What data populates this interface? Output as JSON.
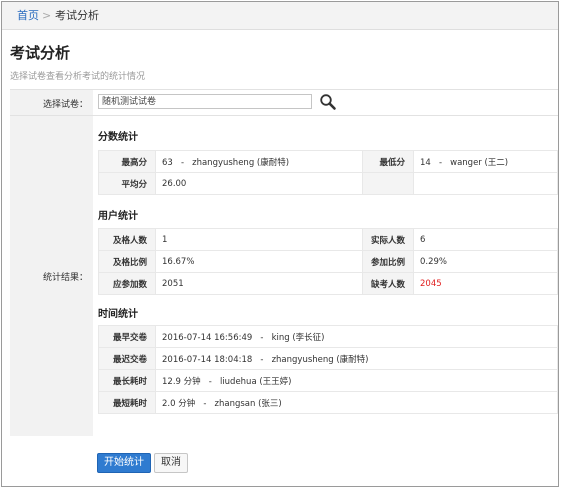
{
  "breadcrumb": {
    "home": "首页",
    "separator": ">",
    "current": "考试分析"
  },
  "page": {
    "title": "考试分析",
    "subtitle": "选择试卷查看分析考试的统计情况"
  },
  "form": {
    "select_label": "选择试卷：",
    "select_value": "随机测试试卷",
    "result_label": "统计结果："
  },
  "score_stats": {
    "title": "分数统计",
    "max_label": "最高分",
    "max_score": "63",
    "max_user": "zhangyusheng (康耐特)",
    "min_label": "最低分",
    "min_score": "14",
    "min_user": "wanger (王二)",
    "avg_label": "平均分",
    "avg_value": "26.00",
    "dash": "-"
  },
  "user_stats": {
    "title": "用户统计",
    "pass_count_label": "及格人数",
    "pass_count": "1",
    "actual_label": "实际人数",
    "actual": "6",
    "pass_rate_label": "及格比例",
    "pass_rate": "16.67%",
    "attend_rate_label": "参加比例",
    "attend_rate": "0.29%",
    "expected_label": "应参加数",
    "expected": "2051",
    "absent_label": "缺考人数",
    "absent": "2045"
  },
  "time_stats": {
    "title": "时间统计",
    "earliest_label": "最早交卷",
    "earliest_time": "2016-07-14 16:56:49",
    "earliest_user": "king (李长征)",
    "latest_label": "最迟交卷",
    "latest_time": "2016-07-14 18:04:18",
    "latest_user": "zhangyusheng (康耐特)",
    "longest_label": "最长耗时",
    "longest_time": "12.9 分钟",
    "longest_user": "liudehua (王王婷)",
    "shortest_label": "最短耗时",
    "shortest_time": "2.0 分钟",
    "shortest_user": "zhangsan (张三)",
    "dash": "-"
  },
  "buttons": {
    "start": "开始统计",
    "cancel": "取消"
  },
  "colors": {
    "accent": "#2f7bd0",
    "link": "#2a6cbf",
    "absent": "#e02020"
  }
}
